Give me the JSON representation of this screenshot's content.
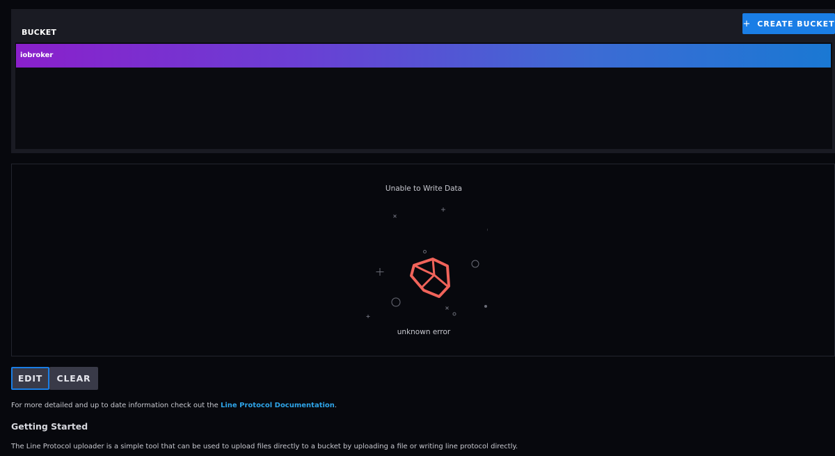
{
  "bucket_panel": {
    "header_label": "BUCKET",
    "create_button_label": "CREATE BUCKET",
    "create_button_icon": "plus-icon",
    "buckets": [
      {
        "name": "iobroker",
        "selected": true
      }
    ]
  },
  "write_panel": {
    "title": "Unable to Write Data",
    "error_icon": "broken-cube-icon",
    "error_message": "unknown error"
  },
  "mode_buttons": {
    "edit_label": "EDIT",
    "clear_label": "CLEAR",
    "active": "EDIT"
  },
  "info": {
    "prefix": "For more detailed and up to date information check out the ",
    "link_text": "Line Protocol Documentation",
    "suffix": "."
  },
  "getting_started": {
    "heading": "Getting Started",
    "description": "The Line Protocol uploader is a simple tool that can be used to upload files directly to a bucket by uploading a file or writing line protocol directly."
  },
  "colors": {
    "background": "#07080d",
    "panel": "#1a1b23",
    "accent": "#1a7ee6",
    "link": "#2ea4e8",
    "error": "#f0635a",
    "gradient_start": "#8a20cb",
    "gradient_end": "#1a78d3"
  }
}
